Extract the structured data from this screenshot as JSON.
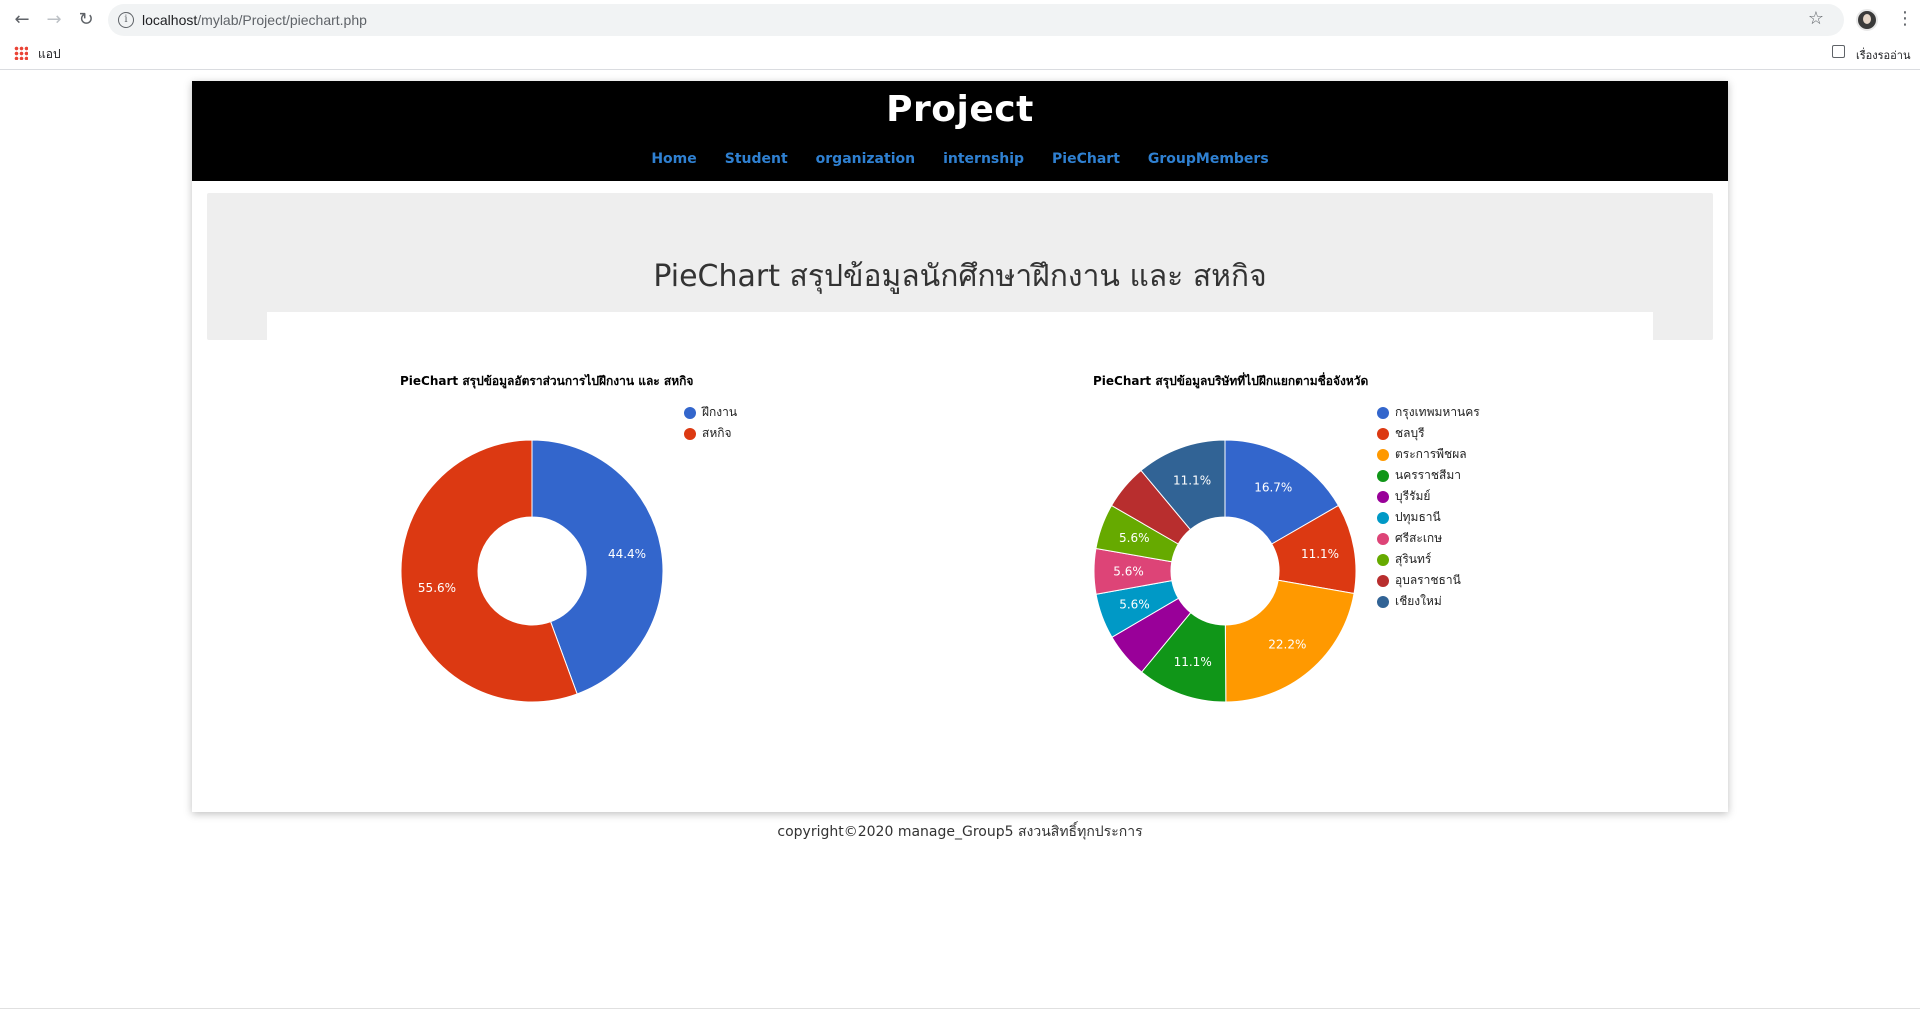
{
  "browser": {
    "url_host": "localhost",
    "url_path": "/mylab/Project/piechart.php",
    "bookmarks_apps_label": "แอป",
    "reading_list_label": "เรื่องรออ่าน"
  },
  "site": {
    "brand": "Project",
    "nav": [
      "Home",
      "Student",
      "organization",
      "internship",
      "PieChart",
      "GroupMembers"
    ],
    "link_color": "#2f80d1"
  },
  "hero": {
    "title": "PieChart สรุปข้อมูลนักศึกษาฝึกงาน และ สหกิจ"
  },
  "chart_data": [
    {
      "type": "pie",
      "variant": "donut",
      "title": "PieChart สรุปข้อมูลอัตราส่วนการไปฝึกงาน และ สหกิจ",
      "legend_position": "right",
      "series": [
        {
          "name": "ฝึกงาน",
          "value": 44.4,
          "label": "44.4%",
          "color": "#3366cc"
        },
        {
          "name": "สหกิจ",
          "value": 55.6,
          "label": "55.6%",
          "color": "#dc3912"
        }
      ]
    },
    {
      "type": "pie",
      "variant": "donut",
      "title": "PieChart สรุปข้อมูลบริษัทที่ไปฝึกแยกตามชื่อจังหวัด",
      "legend_position": "right",
      "series": [
        {
          "name": "กรุงเทพมหานคร",
          "value": 16.7,
          "label": "16.7%",
          "color": "#3366cc"
        },
        {
          "name": "ชลบุรี",
          "value": 11.1,
          "label": "11.1%",
          "color": "#dc3912"
        },
        {
          "name": "ตระการพืชผล",
          "value": 22.2,
          "label": "22.2%",
          "color": "#ff9900"
        },
        {
          "name": "นครราชสีมา",
          "value": 11.1,
          "label": "11.1%",
          "color": "#109618"
        },
        {
          "name": "บุรีรัมย์",
          "value": 5.6,
          "label": "",
          "color": "#990099"
        },
        {
          "name": "ปทุมธานี",
          "value": 5.6,
          "label": "5.6%",
          "color": "#0099c6"
        },
        {
          "name": "ศรีสะเกษ",
          "value": 5.6,
          "label": "5.6%",
          "color": "#dd4477"
        },
        {
          "name": "สุรินทร์",
          "value": 5.6,
          "label": "5.6%",
          "color": "#66aa00"
        },
        {
          "name": "อุบลราชธานี",
          "value": 5.6,
          "label": "",
          "color": "#b82e2e"
        },
        {
          "name": "เชียงใหม่",
          "value": 11.1,
          "label": "11.1%",
          "color": "#316395"
        }
      ]
    }
  ],
  "footer": {
    "text": "copyright©2020 manage_Group5 สงวนสิทธิ์ทุกประการ"
  }
}
